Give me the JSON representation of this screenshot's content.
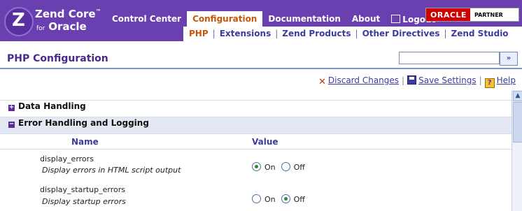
{
  "logo": {
    "brand": "Zend Core",
    "tm": "™",
    "for": "for",
    "product": "Oracle"
  },
  "topnav": {
    "tabs": [
      {
        "label": "Control Center"
      },
      {
        "label": "Configuration"
      },
      {
        "label": "Documentation"
      },
      {
        "label": "About"
      },
      {
        "label": "Logout"
      }
    ]
  },
  "partner_badge": {
    "oracle": "ORACLE",
    "partner": "PARTNER"
  },
  "subnav": {
    "items": [
      {
        "label": "PHP"
      },
      {
        "label": "Extensions"
      },
      {
        "label": "Zend Products"
      },
      {
        "label": "Other Directives"
      },
      {
        "label": "Zend Studio"
      }
    ],
    "separator": "|"
  },
  "page": {
    "title": "PHP Configuration",
    "search_value": "",
    "search_button": "»"
  },
  "actions": {
    "discard": "Discard Changes",
    "save": "Save Settings",
    "help": "Help",
    "separator": "|"
  },
  "sections": [
    {
      "label": "Data Handling",
      "toggle": "+"
    },
    {
      "label": "Error Handling and Logging",
      "toggle": "−"
    }
  ],
  "columns": {
    "name": "Name",
    "value": "Value"
  },
  "directives": [
    {
      "name": "display_errors",
      "description": "Display errors in HTML script output",
      "on_label": "On",
      "off_label": "Off",
      "value": "On"
    },
    {
      "name": "display_startup_errors",
      "description": "Display startup errors",
      "on_label": "On",
      "off_label": "Off",
      "value": "Off"
    }
  ],
  "colors": {
    "header": "#6a3fb0",
    "accent_orange": "#c8560a",
    "link_blue": "#3c3c9c",
    "radio_green": "#2f8a2f"
  }
}
